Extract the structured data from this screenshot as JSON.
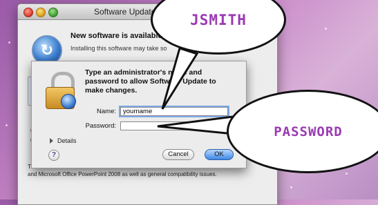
{
  "window": {
    "title": "Software Update"
  },
  "back": {
    "heading": "New software is available",
    "sub": "Installing this software may take so",
    "body": "Th",
    "body2": "and Microsoft Office PowerPoint 2008 as well as general compatibility issues."
  },
  "sheet": {
    "prompt": "Type an administrator's name and password to allow Software Update to make changes.",
    "name_label": "Name:",
    "name_value": "yourname",
    "password_label": "Password:",
    "password_value": "",
    "details_label": "Details",
    "help_label": "?",
    "cancel_label": "Cancel",
    "ok_label": "OK"
  },
  "callouts": {
    "username": "JSMITH",
    "password": "PASSWORD"
  },
  "colors": {
    "callout_text": "#9a3ab2",
    "accent": "#3d87e6"
  }
}
